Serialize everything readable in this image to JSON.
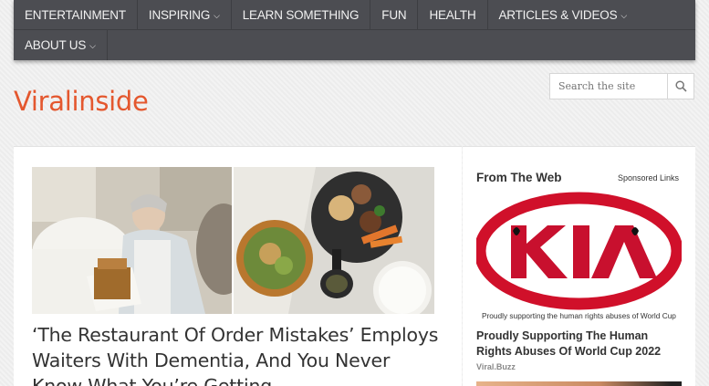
{
  "nav": {
    "row1": [
      {
        "label": "ENTERTAINMENT",
        "dropdown": false
      },
      {
        "label": "INSPIRING",
        "dropdown": true
      },
      {
        "label": "LEARN SOMETHING",
        "dropdown": false
      },
      {
        "label": "FUN",
        "dropdown": false
      },
      {
        "label": "HEALTH",
        "dropdown": false
      },
      {
        "label": "ARTICLES & VIDEOS",
        "dropdown": true
      }
    ],
    "row2": [
      {
        "label": "ABOUT US",
        "dropdown": true
      }
    ],
    "caret": "⌵"
  },
  "brand": {
    "name": "Viralinside",
    "color": "#e4572e"
  },
  "search": {
    "placeholder": "Search the site",
    "icon": "search-icon"
  },
  "article": {
    "title": "‘The Restaurant Of Order Mistakes’ Employs Waiters With Dementia, And You Never Know What You’re Getting"
  },
  "sidebar": {
    "heading": "From The Web",
    "sponsored": "Sponsored Links",
    "ad": {
      "logo_text": "KIA",
      "caption": "Proudly supporting the human rights abuses of World Cup",
      "title": "Proudly Supporting The Human Rights Abuses Of World Cup 2022",
      "source": "Viral.Buzz"
    }
  }
}
